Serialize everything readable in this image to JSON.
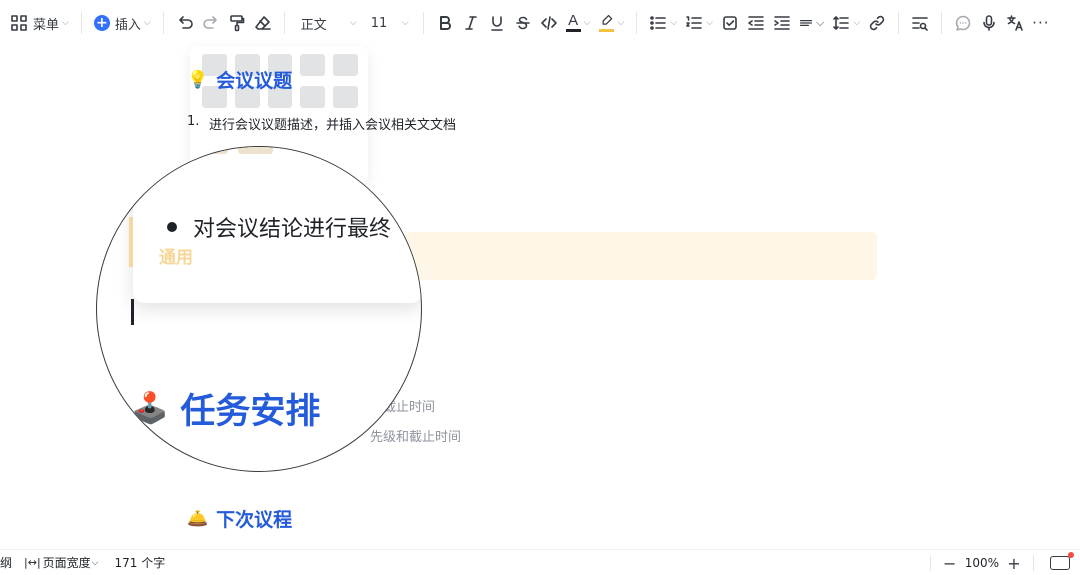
{
  "toolbar": {
    "menu_label": "菜单",
    "insert_label": "插入",
    "text_style": "正文",
    "font_size": "11",
    "colors": {
      "accent": "#3370ff",
      "highlight": "#f5c342"
    }
  },
  "document": {
    "section1": {
      "emoji": "💡",
      "title": "会议议题"
    },
    "section1_item": {
      "number": "1.",
      "text": "进行会议议题描述，并插入会议相关文文档"
    },
    "task_line_1": "和截止时间",
    "task_line_2": "先级和截止时间",
    "section3": {
      "emoji": "🛎️",
      "title": "下次议程"
    }
  },
  "magnifier": {
    "faint_label": "通用",
    "bullet_text": "对会议结论进行最终",
    "heading_emoji": "🕹️",
    "heading_text": "任务安排"
  },
  "statusbar": {
    "outline_label": "纲",
    "page_width_label": "页面宽度",
    "word_count": "171 个字",
    "zoom": "100%"
  }
}
